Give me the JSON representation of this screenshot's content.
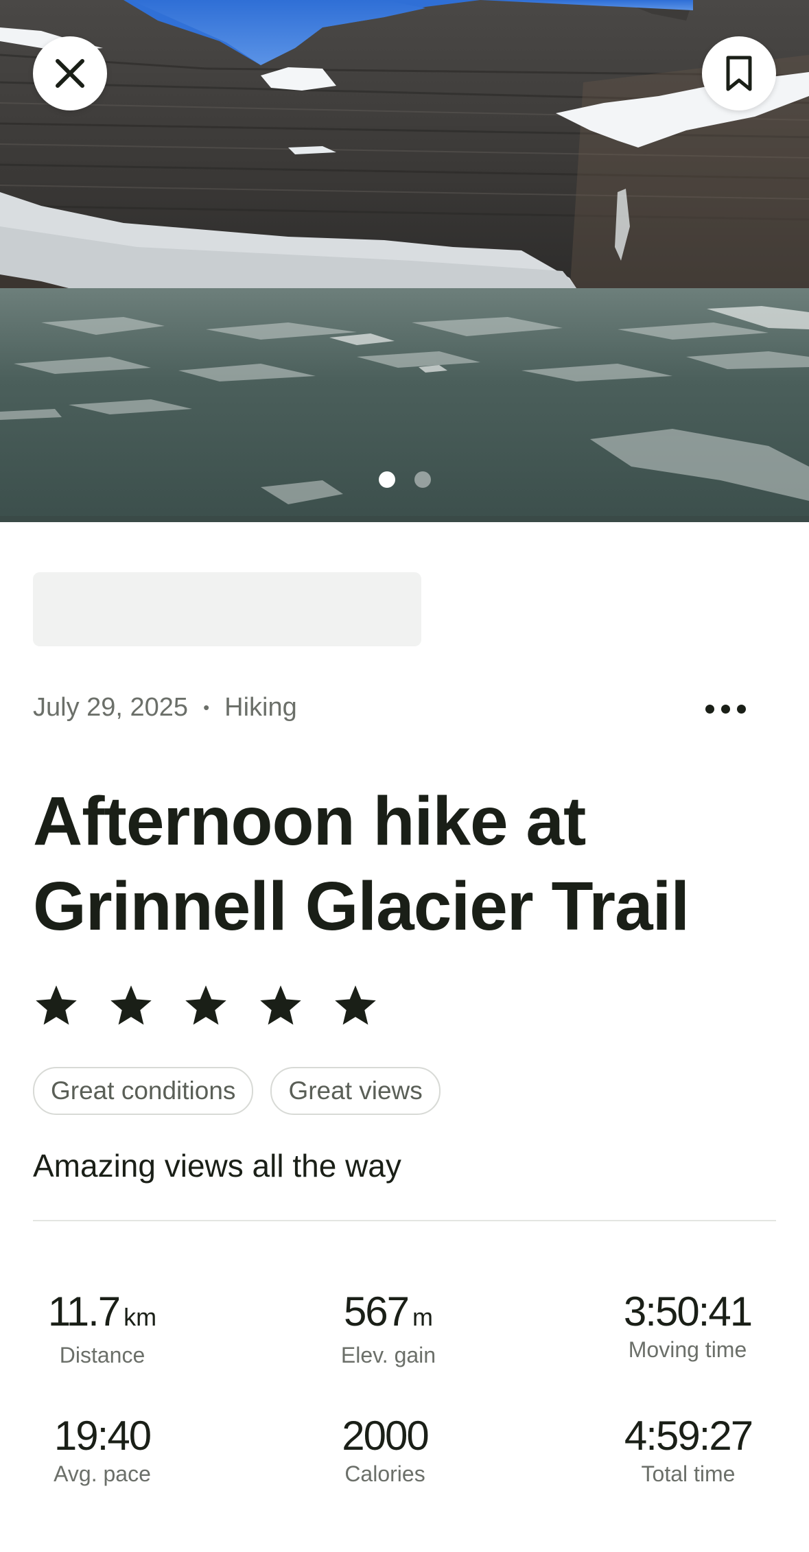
{
  "header": {
    "close_icon": "close-icon",
    "bookmark_icon": "bookmark-icon",
    "photo_count": 2,
    "active_photo": 1
  },
  "activity": {
    "date": "July 29, 2025",
    "separator": "•",
    "type": "Hiking",
    "more_icon": "more-horizontal-icon",
    "title": "Afternoon hike at Grinnell Glacier Trail",
    "rating": 5,
    "rating_max": 5,
    "tags": [
      "Great conditions",
      "Great views"
    ],
    "note": "Amazing views all the way"
  },
  "stats": [
    {
      "value": "11.7",
      "unit": "km",
      "label": "Distance"
    },
    {
      "value": "567",
      "unit": "m",
      "label": "Elev. gain"
    },
    {
      "value": "3:50:41",
      "unit": "",
      "label": "Moving time"
    },
    {
      "value": "19:40",
      "unit": "",
      "label": "Avg. pace"
    },
    {
      "value": "2000",
      "unit": "",
      "label": "Calories"
    },
    {
      "value": "4:59:27",
      "unit": "",
      "label": "Total time"
    }
  ],
  "colors": {
    "text_primary": "#1a1f17",
    "text_secondary": "#6b6f69",
    "chip_border": "#d8dad6",
    "placeholder": "#f1f2f1"
  }
}
